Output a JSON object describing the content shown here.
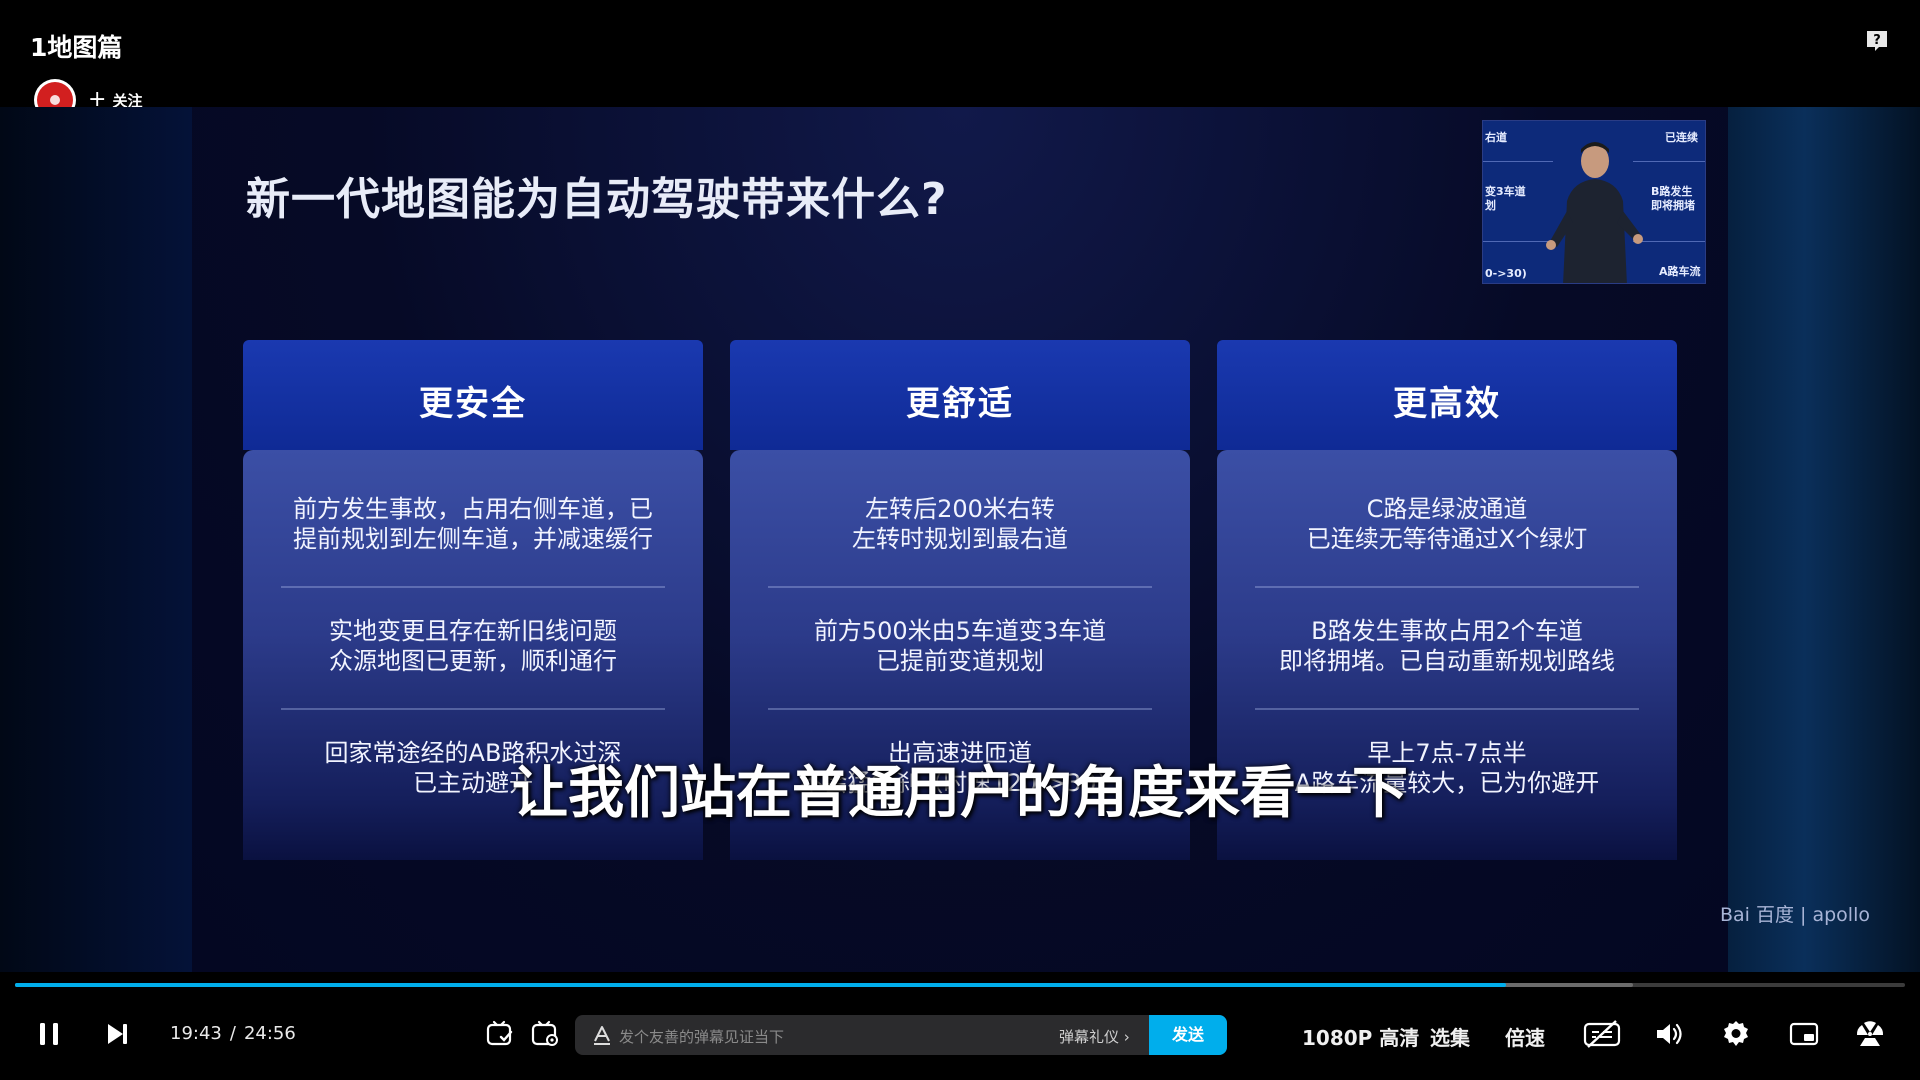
{
  "header": {
    "title": "1地图篇",
    "follow_label": "关注",
    "follow_plus": "+"
  },
  "slide": {
    "title": "新一代地图能为自动驾驶带来什么?",
    "cards": [
      {
        "title": "更安全",
        "items": [
          [
            "前方发生事故，占用右侧车道，已",
            "提前规划到左侧车道，并减速缓行"
          ],
          [
            "实地变更且存在新旧线问题",
            "众源地图已更新，顺利通行"
          ],
          [
            "回家常途经的AB路积水过深",
            "已主动避开"
          ]
        ]
      },
      {
        "title": "更舒适",
        "items": [
          [
            "左转后200米右转",
            "左转时规划到最右道"
          ],
          [
            "前方500米由5车道变3车道",
            "已提前变道规划"
          ],
          [
            "出高速进匝道",
            "不会猛急刹（时速120->30）"
          ]
        ]
      },
      {
        "title": "更高效",
        "items": [
          [
            "C路是绿波通道",
            "已连续无等待通过X个绿灯"
          ],
          [
            "B路发生事故占用2个车道",
            "即将拥堵。已自动重新规划路线"
          ],
          [
            "早上7点-7点半",
            "A路车流量较大，已为你避开"
          ]
        ]
      }
    ],
    "inset_labels": [
      "右道",
      "已连续",
      "变3车道",
      "划",
      "B路发生",
      "即将拥堵",
      "0->30)",
      "A路车流"
    ],
    "brand": "Bai 百度 | apollo"
  },
  "subtitle": "让我们站在普通用户的角度来看一下",
  "player": {
    "current_time": "19:43",
    "time_separator": "/",
    "total_time": "24:56",
    "progress_fraction": 0.789,
    "buffered_fraction": 0.856,
    "danmaku_placeholder": "发个友善的弹幕见证当下",
    "danmaku_gift": "弹幕礼仪 ›",
    "send_label": "发送",
    "quality_label": "1080P 高清",
    "episodes_label": "选集",
    "speed_label": "倍速"
  },
  "colors": {
    "accent": "#00aeec",
    "card_header": "#1a39b0",
    "avatar": "#d21f1f"
  }
}
